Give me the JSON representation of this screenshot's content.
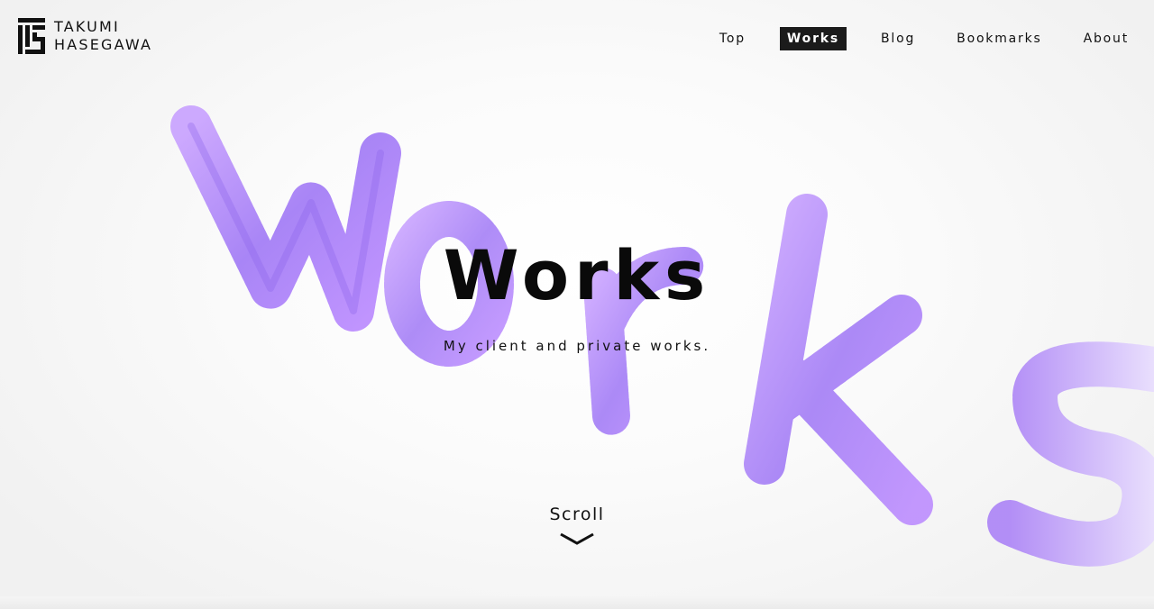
{
  "header": {
    "logo_line1": "TAKUMI",
    "logo_line2": "HASEGAWA",
    "logo_icon": "th-monogram-icon"
  },
  "nav": {
    "items": [
      {
        "label": "Top"
      },
      {
        "label": "Works",
        "active": true
      },
      {
        "label": "Blog"
      },
      {
        "label": "Bookmarks"
      },
      {
        "label": "About"
      }
    ]
  },
  "hero": {
    "title": "Works",
    "subtitle": "My client and private works.",
    "background_art": "scribbled purple 'Works' lettering"
  },
  "scroll": {
    "label": "Scroll",
    "icon": "chevron-down-icon"
  },
  "colors": {
    "accent_purple": "#9b6cf0",
    "accent_lavender": "#c7a3ff",
    "text": "#111111",
    "active_nav_bg": "#1b1b1b"
  }
}
